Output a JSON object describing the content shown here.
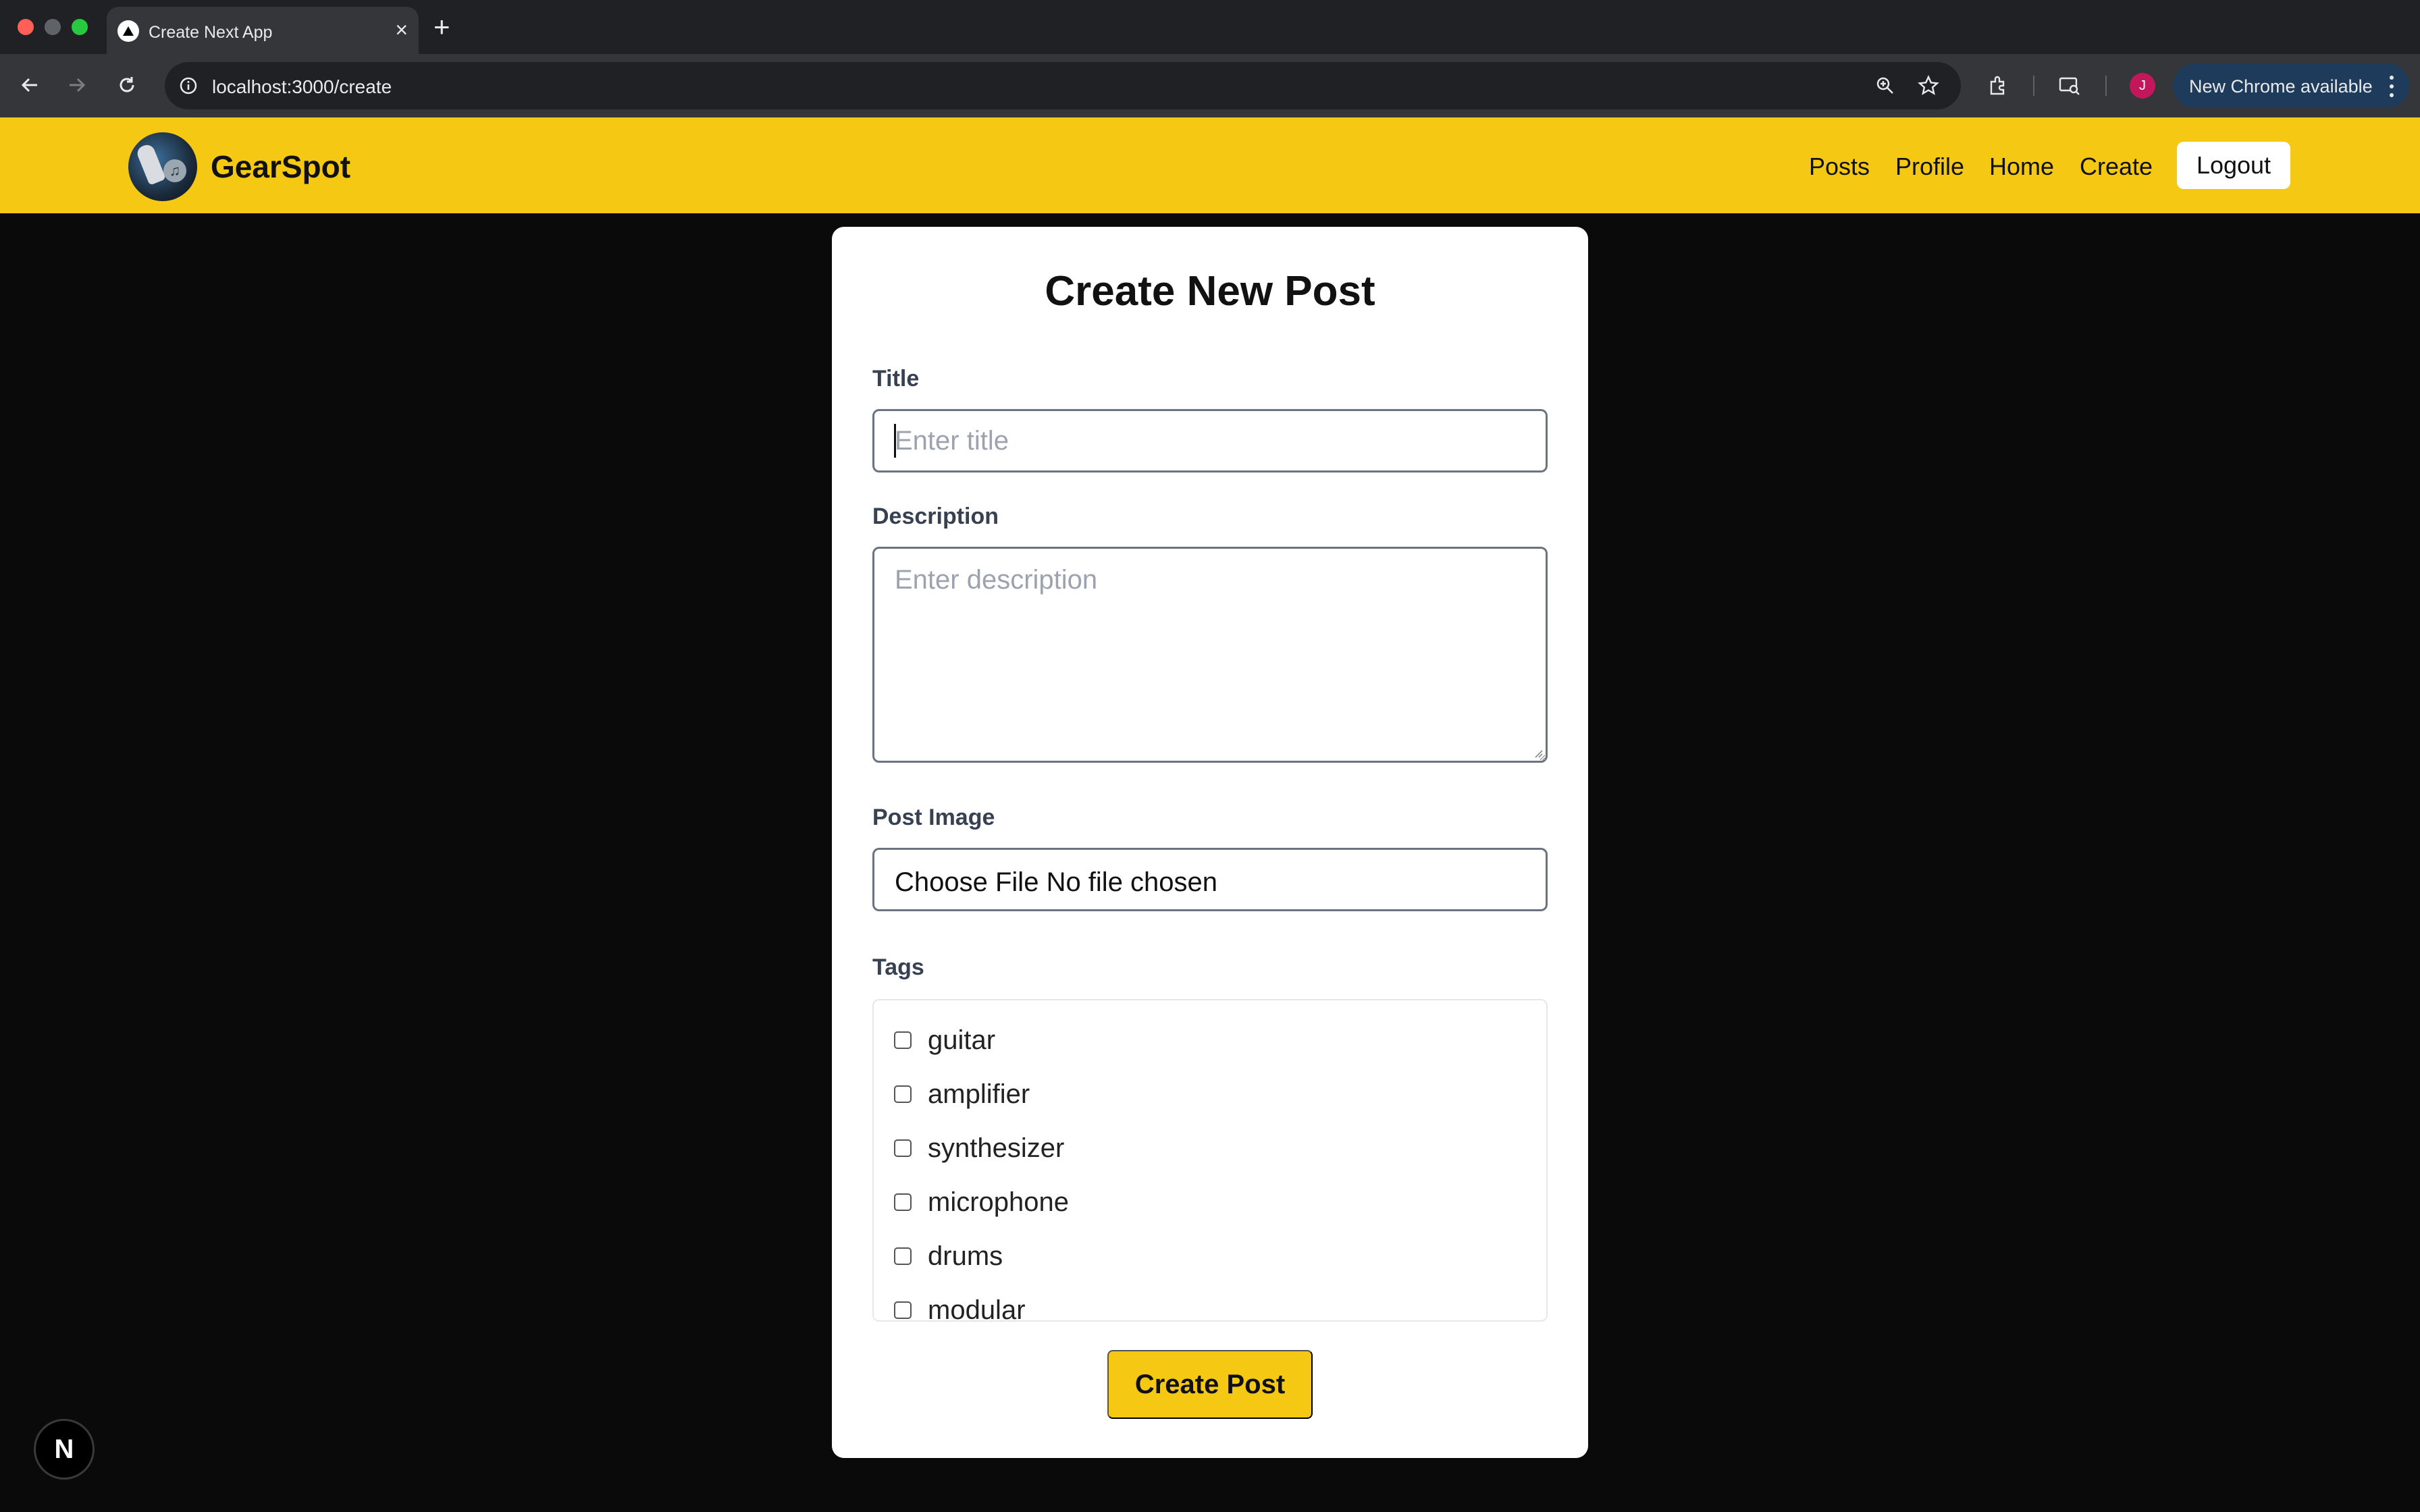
{
  "browser": {
    "tab_title": "Create Next App",
    "tab_close": "×",
    "new_tab": "+",
    "url": "localhost:3000/create",
    "profile_initial": "J",
    "update_label": "New Chrome available"
  },
  "header": {
    "brand": "GearSpot",
    "nav": [
      "Posts",
      "Profile",
      "Home",
      "Create"
    ],
    "logout_label": "Logout",
    "accent_color": "#f5c813"
  },
  "form": {
    "heading": "Create New Post",
    "title_label": "Title",
    "title_placeholder": "Enter title",
    "title_value": "",
    "description_label": "Description",
    "description_placeholder": "Enter description",
    "image_label": "Post Image",
    "file_button_label": "Choose File",
    "file_status": "No file chosen",
    "tags_label": "Tags",
    "tags": [
      "guitar",
      "amplifier",
      "synthesizer",
      "microphone",
      "drums",
      "modular"
    ],
    "submit_label": "Create Post"
  },
  "dev_indicator": {
    "label": "N"
  }
}
